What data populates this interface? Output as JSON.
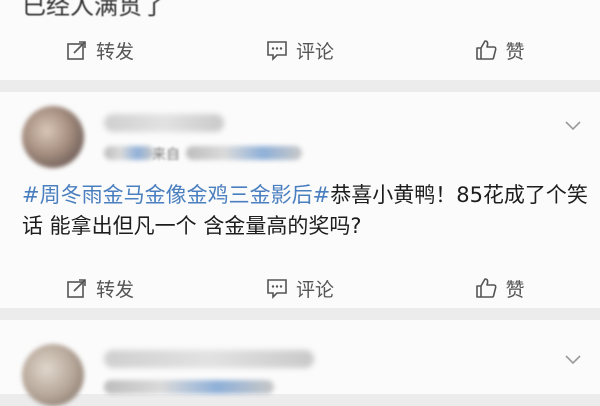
{
  "top_card": {
    "cut_text": "已经人满贯了"
  },
  "actions": {
    "repost": "转发",
    "comment": "评论",
    "like": "赞"
  },
  "mid_card": {
    "source": "来自",
    "hashtag": "#周冬雨金马金像金鸡三金影后#",
    "body": "恭喜小黄鸭！85花成了个笑话 能拿出但凡一个 含金量高的奖吗?"
  },
  "colors": {
    "link": "#4a7fbf",
    "card_bg": "#fbfbfb",
    "page_bg": "#ececec"
  },
  "icons": [
    "repost-icon",
    "comment-icon",
    "like-icon",
    "chevron-down-icon"
  ]
}
